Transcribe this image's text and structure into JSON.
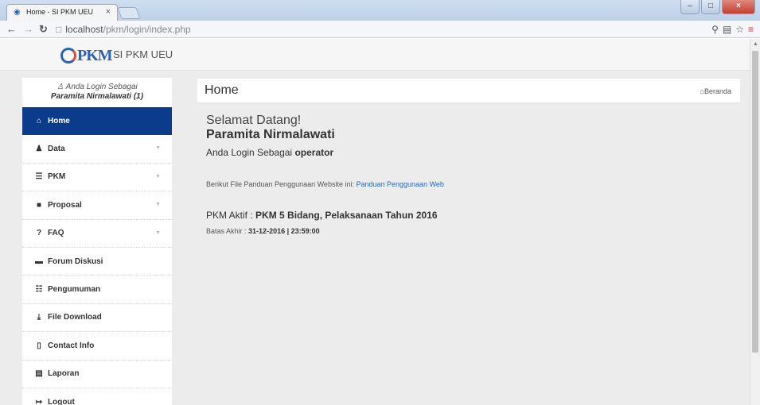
{
  "browser": {
    "tab_title": "Home - SI PKM UEU",
    "url_host": "localhost",
    "url_path": "/pkm/login/index.php"
  },
  "brand": {
    "logo_text": "PKM",
    "name": "SI PKM UEU"
  },
  "user": {
    "login_label": "Anda Login Sebagai",
    "name_with_count": "Paramita Nirmalawati (1)"
  },
  "sidebar": {
    "items": [
      {
        "label": "Home",
        "icon": "home-icon",
        "glyph": "⌂",
        "active": true,
        "has_caret": false
      },
      {
        "label": "Data",
        "icon": "user-icon",
        "glyph": "♟",
        "active": false,
        "has_caret": true
      },
      {
        "label": "PKM",
        "icon": "list-icon",
        "glyph": "☰",
        "active": false,
        "has_caret": true
      },
      {
        "label": "Proposal",
        "icon": "book-icon",
        "glyph": "■",
        "active": false,
        "has_caret": true
      },
      {
        "label": "FAQ",
        "icon": "question-icon",
        "glyph": "?",
        "active": false,
        "has_caret": true
      },
      {
        "label": "Forum Diskusi",
        "icon": "comment-icon",
        "glyph": "▬",
        "active": false,
        "has_caret": false
      },
      {
        "label": "Pengumuman",
        "icon": "grid-icon",
        "glyph": "☷",
        "active": false,
        "has_caret": false
      },
      {
        "label": "File Download",
        "icon": "download-icon",
        "glyph": "⤓",
        "active": false,
        "has_caret": false
      },
      {
        "label": "Contact Info",
        "icon": "phone-icon",
        "glyph": "▯",
        "active": false,
        "has_caret": false
      },
      {
        "label": "Laporan",
        "icon": "report-icon",
        "glyph": "▤",
        "active": false,
        "has_caret": false
      },
      {
        "label": "Logout",
        "icon": "logout-icon",
        "glyph": "↦",
        "active": false,
        "has_caret": false
      }
    ]
  },
  "header": {
    "title": "Home",
    "breadcrumb": "Beranda"
  },
  "main": {
    "welcome": "Selamat Datang!",
    "user_name": "Paramita Nirmalawati",
    "login_as_prefix": "Anda Login Sebagai",
    "role": "operator",
    "guide_text": "Berikut File Panduan Penggunaan Website ini:",
    "guide_link": "Panduan Penggunaan Web",
    "pkm_active_label": "PKM Aktif :",
    "pkm_active_value": "PKM 5 Bidang, Pelaksanaan Tahun 2016",
    "deadline_label": "Batas Akhir :",
    "deadline_value": "31-12-2016 | 23:59:00"
  },
  "colors": {
    "active_menu": "#0b3c8c",
    "link": "#2a6ab8",
    "brand_blue": "#2a63b4"
  }
}
